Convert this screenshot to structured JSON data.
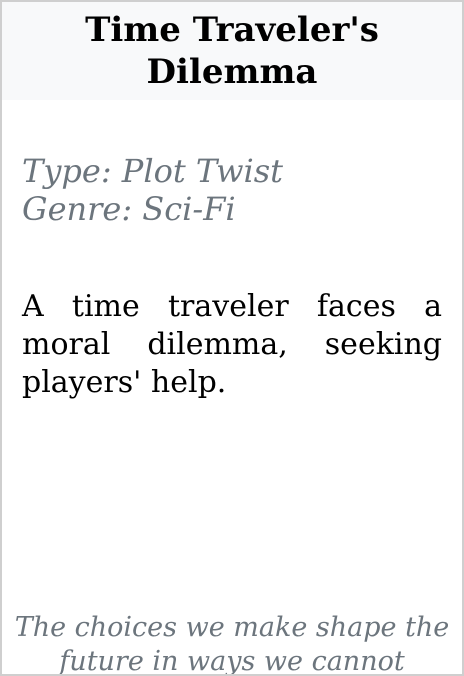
{
  "card": {
    "title": "Time Traveler's Dilemma",
    "type_line": "Type: Plot Twist",
    "genre_line": "Genre: Sci-Fi",
    "description": "A time traveler faces a moral dilemma, seeking players' help.",
    "quote": "The choices we make shape the future in ways we cannot"
  },
  "colors": {
    "header_background": "#f8f9fa",
    "muted_text": "#6c757d",
    "border": "#cfcfcf"
  }
}
